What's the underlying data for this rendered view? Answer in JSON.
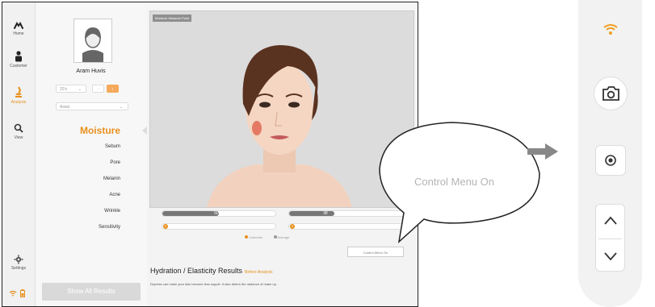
{
  "nav": {
    "items": [
      {
        "label": "Home",
        "icon": "home-icon"
      },
      {
        "label": "Customer",
        "icon": "person-icon"
      },
      {
        "label": "Analysis",
        "icon": "microscope-icon",
        "active": true
      },
      {
        "label": "View",
        "icon": "magnifier-icon"
      },
      {
        "label": "Settings",
        "icon": "gear-icon"
      }
    ],
    "status_icons": [
      "wifi-icon",
      "battery-icon"
    ]
  },
  "customer": {
    "name": "Aram Huvis",
    "age_select": "20's",
    "ethnicity_select": "Asian",
    "gender_options": [
      "male",
      "female"
    ],
    "selected_gender": "female"
  },
  "analysis_menu": {
    "items": [
      "Moisture",
      "Sebum",
      "Pore",
      "Melanin",
      "Acne",
      "Wrinkle",
      "Sensitivity"
    ],
    "selected": "Moisture"
  },
  "show_all_label": "Show All Results",
  "face_panel": {
    "label": "Moisture Measure Point"
  },
  "results": {
    "customer_value": "50",
    "average_value": "38",
    "customer_pct": 0.5,
    "average_pct": 0.38,
    "legend_customer": "Customer",
    "legend_average": "Average",
    "control_menu_label": "Control Menu On",
    "title": "Hydration / Elasticity Results",
    "title_badge": "Before Analysis",
    "description": "Dryness can make your skin become less supple. It also deters the radiance of make up."
  },
  "callout": {
    "text": "Control Menu On"
  },
  "colors": {
    "accent": "#e8901c",
    "bar": "#777777"
  },
  "right_panel": {
    "buttons": [
      "wifi-icon",
      "camera-icon",
      "record-icon",
      "chevron-up-icon",
      "chevron-down-icon"
    ]
  }
}
